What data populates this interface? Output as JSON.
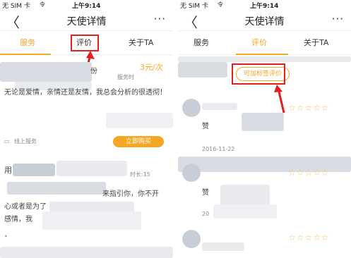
{
  "status": {
    "carrier": "无 SIM 卡",
    "wifi": "令",
    "time": "上午9:14"
  },
  "nav": {
    "back": "〈",
    "title": "天使详情",
    "more": "···"
  },
  "tabs": {
    "service": "服务",
    "review": "评价",
    "about": "关于TA"
  },
  "left": {
    "price": "3元/次",
    "service_time": "服务时",
    "bio": "无论是爱情，亲情还是友情，我总会分析的很透彻！",
    "online_service": "线上服务",
    "buy": "立即购买",
    "user_prefix": "用",
    "duration": "时长:15",
    "msg_fragment_1": "来指引你，你不开",
    "msg_fragment_2": "心或者是为了",
    "msg_fragment_3": "感情，我",
    "dot": "•"
  },
  "right": {
    "filter_label": "可加标签评价",
    "review1_text": "赞",
    "review1_date": "2016-11-22",
    "review2_text": "赞",
    "review2_date_prefix": "20",
    "stars": "☆☆☆☆☆"
  }
}
